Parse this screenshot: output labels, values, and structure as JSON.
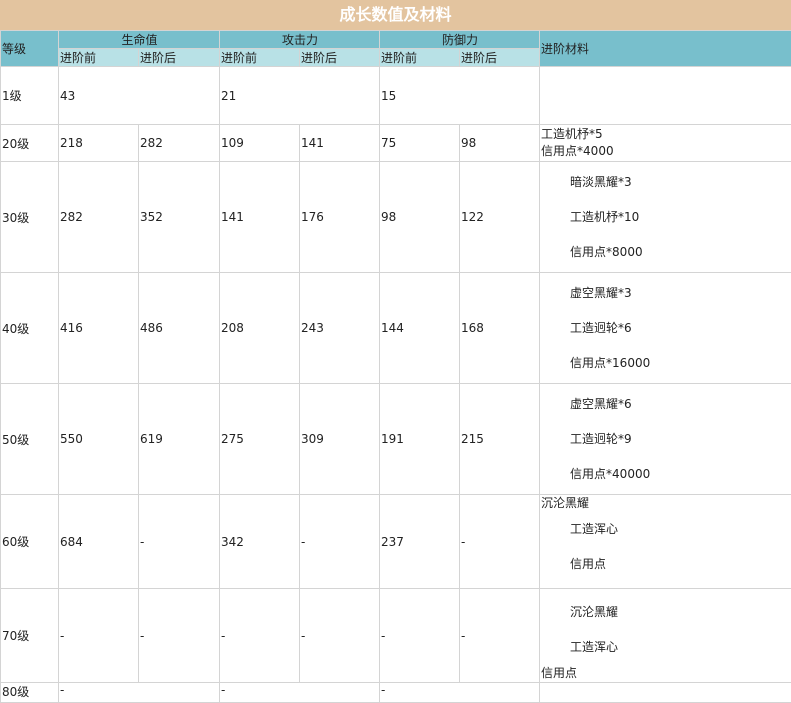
{
  "title": "成长数值及材料",
  "headers": {
    "level": "等级",
    "hp": "生命值",
    "atk": "攻击力",
    "def": "防御力",
    "materials": "进阶材料",
    "before": "进阶前",
    "after": "进阶后"
  },
  "rows": [
    {
      "level": "1级",
      "hp_before": "43",
      "hp_after": "",
      "atk_before": "21",
      "atk_after": "",
      "def_before": "15",
      "def_after": "",
      "materials": []
    },
    {
      "level": "20级",
      "hp_before": "218",
      "hp_after": "282",
      "atk_before": "109",
      "atk_after": "141",
      "def_before": "75",
      "def_after": "98",
      "materials": [
        "工造机杼*5",
        "信用点*4000"
      ]
    },
    {
      "level": "30级",
      "hp_before": "282",
      "hp_after": "352",
      "atk_before": "141",
      "atk_after": "176",
      "def_before": "98",
      "def_after": "122",
      "materials": [
        "暗淡黑耀*3",
        "工造机杼*10",
        "信用点*8000"
      ]
    },
    {
      "level": "40级",
      "hp_before": "416",
      "hp_after": "486",
      "atk_before": "208",
      "atk_after": "243",
      "def_before": "144",
      "def_after": "168",
      "materials": [
        "虚空黑耀*3",
        "工造迥轮*6",
        "信用点*16000"
      ]
    },
    {
      "level": "50级",
      "hp_before": "550",
      "hp_after": "619",
      "atk_before": "275",
      "atk_after": "309",
      "def_before": "191",
      "def_after": "215",
      "materials": [
        "虚空黑耀*6",
        "工造迥轮*9",
        "信用点*40000"
      ]
    },
    {
      "level": "60级",
      "hp_before": "684",
      "hp_after": "-",
      "atk_before": "342",
      "atk_after": "-",
      "def_before": "237",
      "def_after": "-",
      "materials": [
        "沉沦黑耀",
        "工造浑心",
        "信用点"
      ]
    },
    {
      "level": "70级",
      "hp_before": "-",
      "hp_after": "-",
      "atk_before": "-",
      "atk_after": "-",
      "def_before": "-",
      "def_after": "-",
      "materials": [
        "沉沦黑耀",
        "工造浑心",
        "信用点"
      ]
    },
    {
      "level": "80级",
      "hp_before": "-",
      "hp_after": "",
      "atk_before": "-",
      "atk_after": "",
      "def_before": "-",
      "def_after": "",
      "materials": []
    }
  ]
}
